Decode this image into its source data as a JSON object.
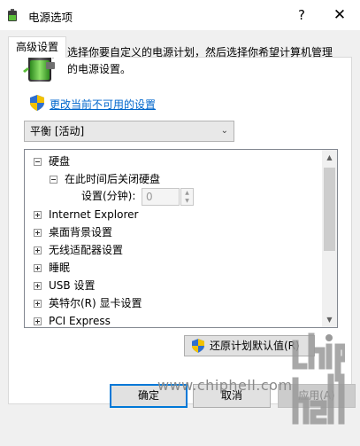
{
  "window": {
    "title": "电源选项",
    "help_label": "?",
    "close_label": "✕"
  },
  "tabs": [
    {
      "label": "高级设置",
      "active": true
    }
  ],
  "header": {
    "description": "选择你要自定义的电源计划，然后选择你希望计算机管理的电源设置。",
    "change_link": "更改当前不可用的设置"
  },
  "plan_select": {
    "value": "平衡 [活动]"
  },
  "tree": {
    "items": [
      {
        "label": "硬盘",
        "expanded": true,
        "level": 0
      },
      {
        "label": "在此时间后关闭硬盘",
        "expanded": true,
        "level": 1
      },
      {
        "label": "Internet Explorer",
        "expanded": false,
        "level": 0
      },
      {
        "label": "桌面背景设置",
        "expanded": false,
        "level": 0
      },
      {
        "label": "无线适配器设置",
        "expanded": false,
        "level": 0
      },
      {
        "label": "睡眠",
        "expanded": false,
        "level": 0
      },
      {
        "label": "USB 设置",
        "expanded": false,
        "level": 0
      },
      {
        "label": "英特尔(R) 显卡设置",
        "expanded": false,
        "level": 0
      },
      {
        "label": "PCI Express",
        "expanded": false,
        "level": 0
      }
    ],
    "setting_label": "设置(分钟):",
    "setting_value": "0"
  },
  "restore_button": "还原计划默认值(R)",
  "buttons": {
    "ok": "确定",
    "cancel": "取消",
    "apply": "应用(A)"
  },
  "watermark": {
    "text": "www.chiphell.com",
    "logo_text": "chip hell"
  },
  "colors": {
    "link": "#0066cc",
    "focus_border": "#0078d7",
    "dialog_bg": "#f0f0f0"
  }
}
